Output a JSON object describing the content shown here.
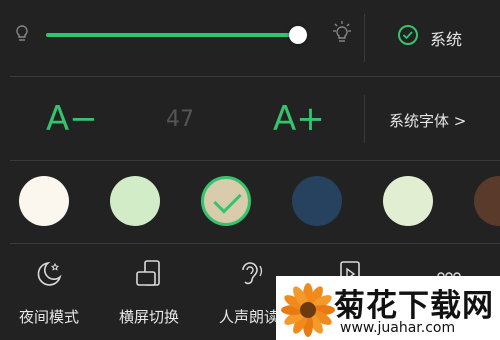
{
  "brightness": {
    "level": 0.96,
    "system_label": "系统",
    "system_checked": true
  },
  "font": {
    "decrease_label": "A−",
    "size": "47",
    "increase_label": "A+",
    "system_font_label": "系统字体 >"
  },
  "themes": {
    "colors": [
      "#fbf7ef",
      "#d2ecc8",
      "#d9ccac",
      "#26425e",
      "#e1eed2",
      "#5a3a2a"
    ],
    "selected_index": 2
  },
  "toolbar": {
    "items": [
      {
        "label": "夜间模式",
        "icon": "moon-icon"
      },
      {
        "label": "横屏切换",
        "icon": "rotate-screen-icon"
      },
      {
        "label": "人声朗读",
        "icon": "ear-icon"
      },
      {
        "label": "",
        "icon": "play-icon"
      },
      {
        "label": "",
        "icon": "more-icon"
      }
    ]
  },
  "watermark": {
    "title": "菊花下载网",
    "url": "www.juahar.com"
  },
  "colors": {
    "accent": "#35c46e",
    "background": "#222222"
  }
}
